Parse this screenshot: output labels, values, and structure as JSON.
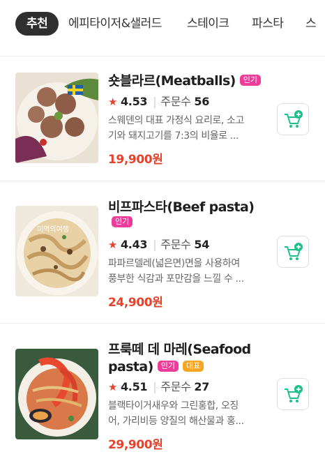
{
  "categories": [
    {
      "label": "추천",
      "active": true
    },
    {
      "label": "에피타이저&샐러드",
      "active": false
    },
    {
      "label": "스테이크",
      "active": false
    },
    {
      "label": "파스타",
      "active": false
    },
    {
      "label": "스",
      "active": false
    }
  ],
  "menu_items": [
    {
      "name": "숏블라르(Meatballs)",
      "badges": [
        "인기"
      ],
      "rating": "4.53",
      "orders_label": "주문수",
      "orders": "56",
      "desc_lines": [
        "스웨덴의 대표 가정식 요리로, 소고",
        "기와 돼지고기를 7:3의 비율로 ..."
      ],
      "price": "19,900원"
    },
    {
      "name": "비프파스타(Beef pasta)",
      "badges": [
        "인기"
      ],
      "rating": "4.43",
      "orders_label": "주문수",
      "orders": "54",
      "desc_lines": [
        "파파르델레(넓은면)면을 사용하여",
        "풍부한 식감과 포만감을 느낄 수 ..."
      ],
      "price": "24,900원",
      "image_watermark": "미역의여행"
    },
    {
      "name_line1": "프룩떼 데 마레(Seafood",
      "name_line2": "pasta)",
      "badges": [
        "인기",
        "대표"
      ],
      "rating": "4.51",
      "orders_label": "주문수",
      "orders": "27",
      "desc_lines": [
        "블랙타이거새우와 그린홍합, 오징",
        "어, 가리비등 양질의 해산물과 홍..."
      ],
      "price": "29,900원"
    }
  ],
  "icons": {
    "cart": "cart-plus-icon",
    "star": "star-icon"
  },
  "colors": {
    "accent_red": "#e6412a",
    "badge_pink": "#ec3d9a",
    "badge_orange": "#f6a623",
    "cart_green": "#1ec08a",
    "tab_active_bg": "#2f2f2f"
  }
}
